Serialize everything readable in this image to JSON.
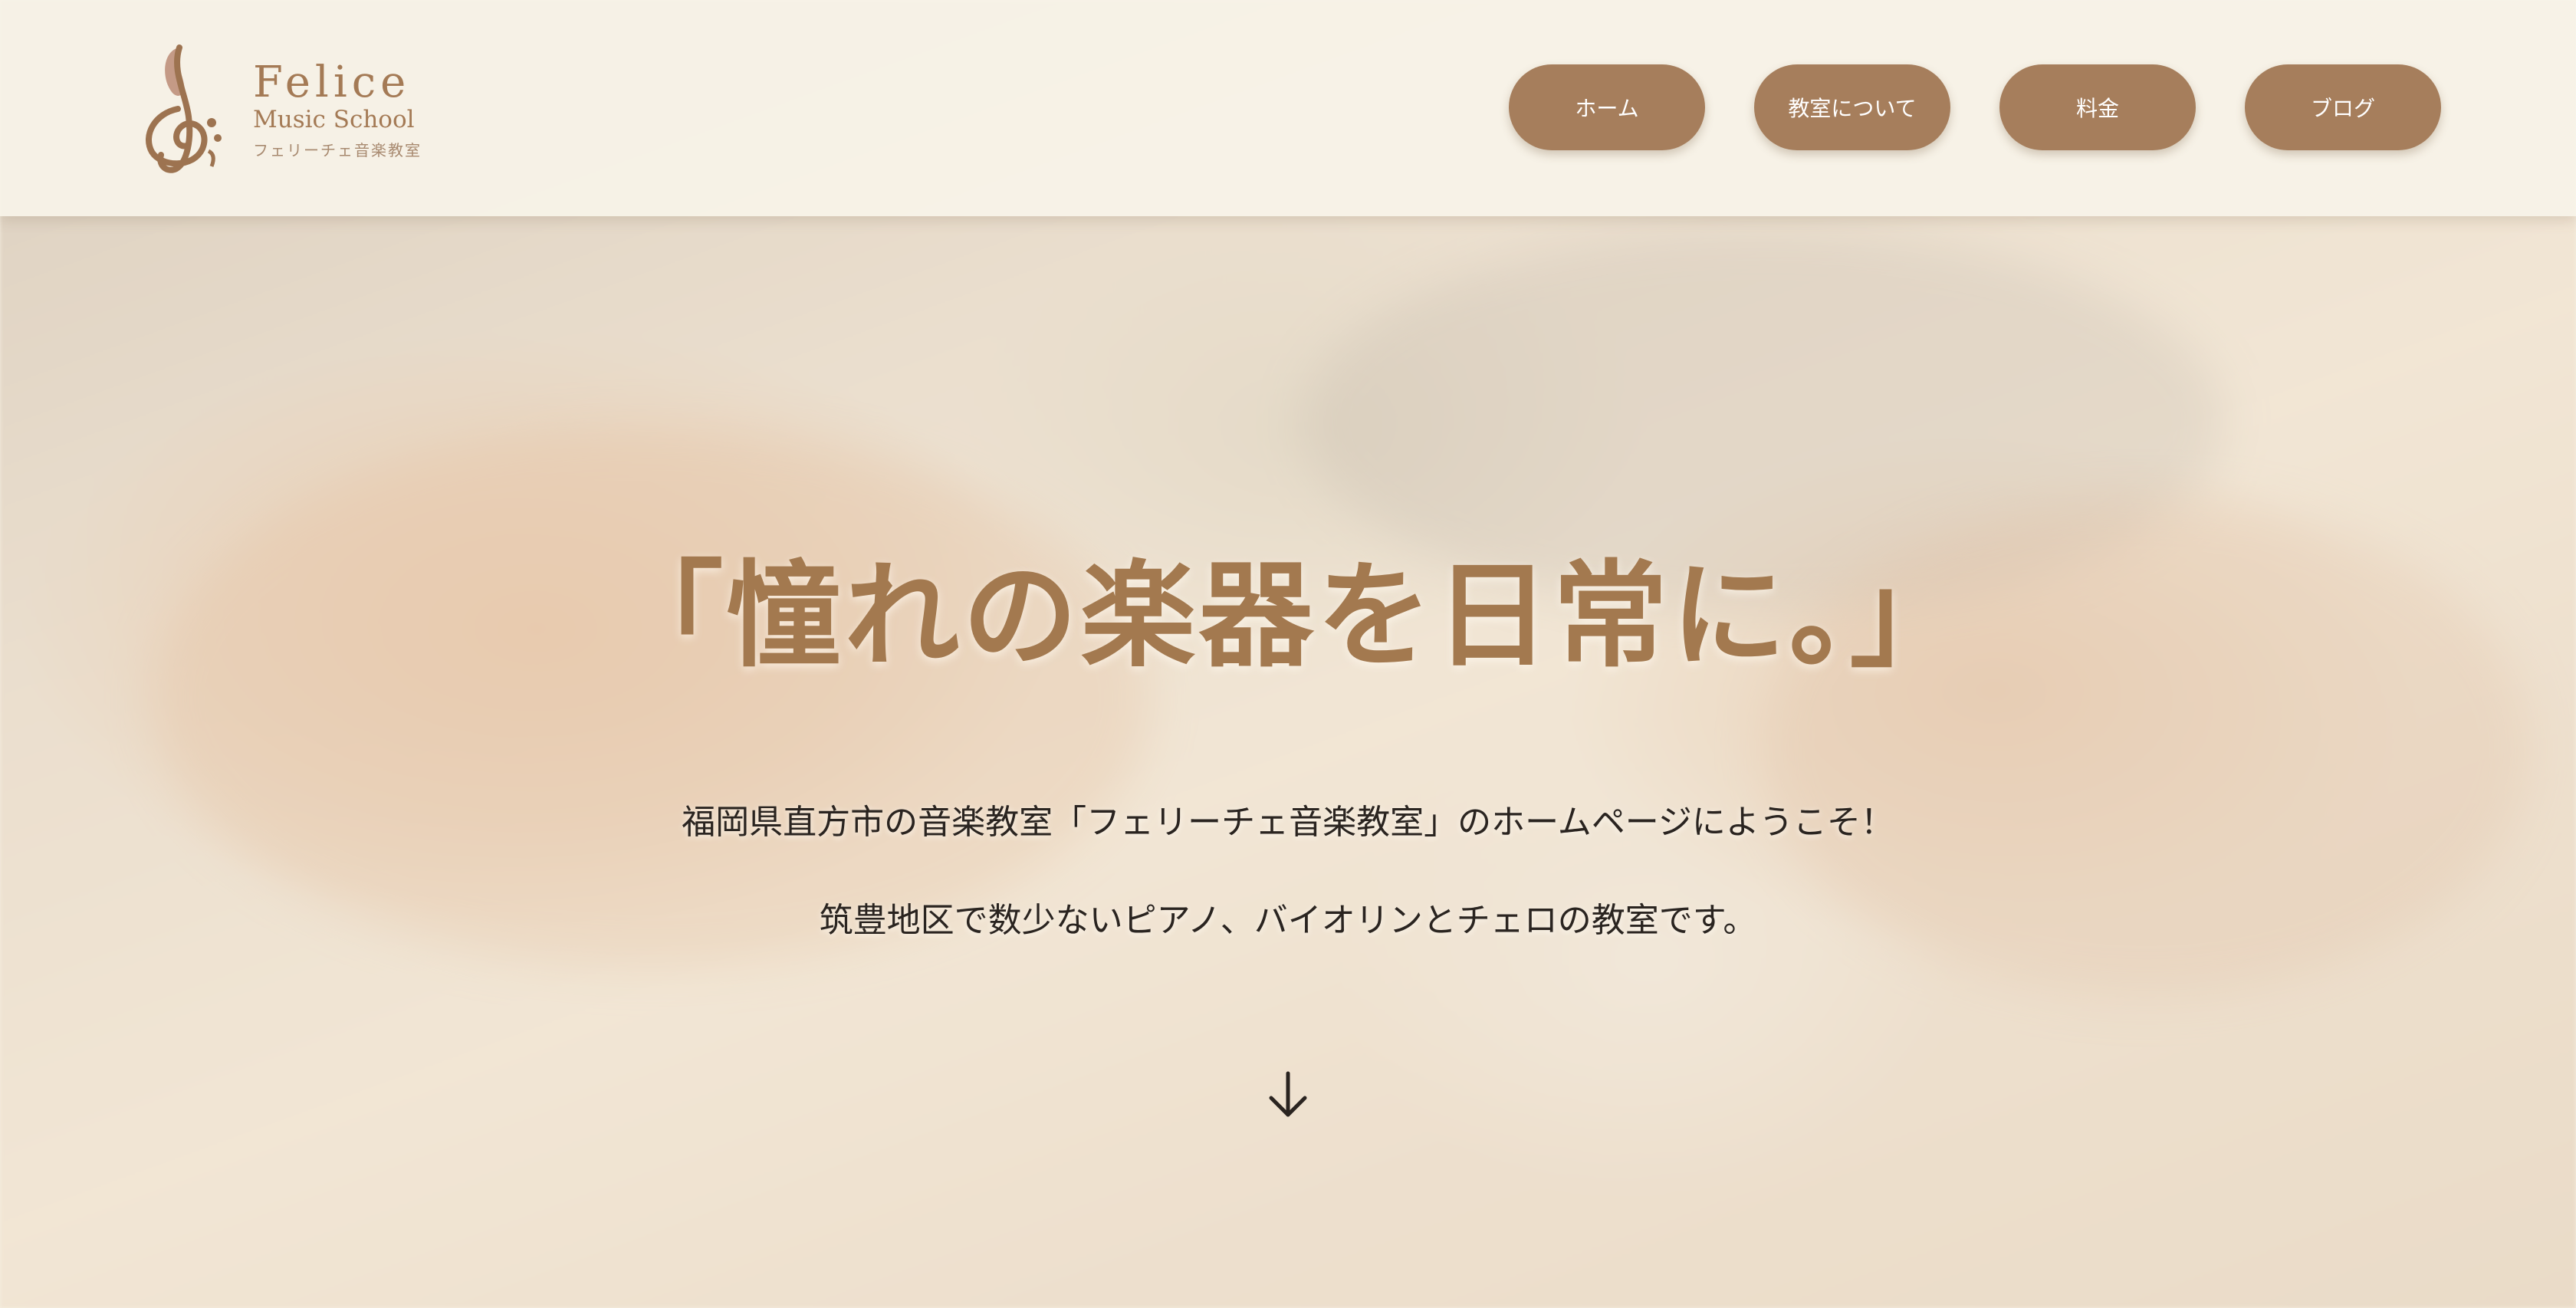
{
  "brand": {
    "name": "Felice",
    "subtitle": "Music School",
    "japanese_name": "フェリーチェ音楽教室",
    "logo_icon": "treble-clef-icon",
    "accent_color": "#a67e5c"
  },
  "nav": {
    "items": [
      {
        "label": "ホーム"
      },
      {
        "label": "教室について"
      },
      {
        "label": "料金"
      },
      {
        "label": "ブログ"
      }
    ]
  },
  "hero": {
    "headline": "「憧れの楽器を日常に。」",
    "intro_line_1": "福岡県直方市の音楽教室「フェリーチェ音楽教室」のホームページにようこそ！",
    "intro_line_2": "筑豊地区で数少ないピアノ、バイオリンとチェロの教室です。",
    "scroll_icon": "arrow-down-icon",
    "headline_color": "#a3794f"
  }
}
